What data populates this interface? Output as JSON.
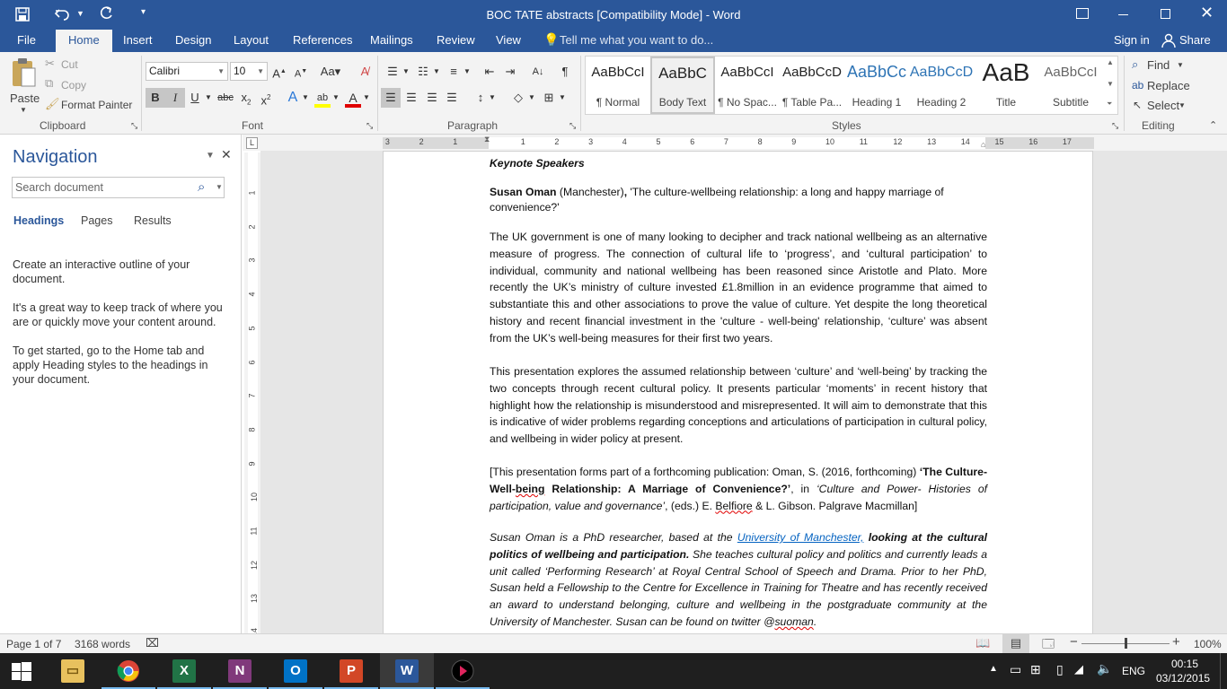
{
  "title_bar": {
    "title": "BOC TATE abstracts [Compatibility Mode] - Word"
  },
  "tabs": {
    "file": "File",
    "home": "Home",
    "insert": "Insert",
    "design": "Design",
    "layout": "Layout",
    "references": "References",
    "mailings": "Mailings",
    "review": "Review",
    "view": "View",
    "tell_me": "Tell me what you want to do...",
    "sign_in": "Sign in",
    "share": "Share"
  },
  "clipboard": {
    "paste": "Paste",
    "cut": "Cut",
    "copy": "Copy",
    "format_painter": "Format Painter",
    "label": "Clipboard"
  },
  "font": {
    "name": "Calibri",
    "size": "10",
    "label": "Font",
    "colors": {
      "highlight": "#ffff00",
      "font_color": "#e00000"
    }
  },
  "paragraph": {
    "label": "Paragraph"
  },
  "styles": {
    "label": "Styles",
    "items": [
      {
        "preview": "AaBbCcI",
        "name": "¶ Normal"
      },
      {
        "preview": "AaBbC",
        "name": "Body Text"
      },
      {
        "preview": "AaBbCcI",
        "name": "¶ No Spac..."
      },
      {
        "preview": "AaBbCcD",
        "name": "¶ Table Pa..."
      },
      {
        "preview": "AaBbCc",
        "name": "Heading 1"
      },
      {
        "preview": "AaBbCcD",
        "name": "Heading 2"
      },
      {
        "preview": "AaB",
        "name": "Title"
      },
      {
        "preview": "AaBbCcI",
        "name": "Subtitle"
      }
    ]
  },
  "editing": {
    "find": "Find",
    "replace": "Replace",
    "select": "Select",
    "label": "Editing"
  },
  "ruler": {
    "numbers": [
      "3",
      "2",
      "1",
      "1",
      "2",
      "3",
      "4",
      "5",
      "6",
      "7",
      "8",
      "9",
      "10",
      "11",
      "12",
      "13",
      "14",
      "15",
      "16",
      "17"
    ],
    "vnumbers": [
      "1",
      "2",
      "3",
      "4",
      "5",
      "6",
      "7",
      "8",
      "9",
      "10",
      "11",
      "12",
      "13",
      "14"
    ]
  },
  "navigation": {
    "title": "Navigation",
    "search_placeholder": "Search document",
    "tabs": [
      "Headings",
      "Pages",
      "Results"
    ],
    "para1": "Create an interactive outline of your document.",
    "para2": "It's a great way to keep track of where you are or quickly move your content around.",
    "para3": "To get started, go to the Home tab and apply Heading styles to the headings in your document."
  },
  "document": {
    "heading": "Keynote Speakers",
    "speaker_name": "Susan Oman",
    "speaker_place": " (Manchester)",
    "speaker_comma": ",",
    "talk_title": " 'The culture-wellbeing relationship: a long and happy marriage of convenience?'",
    "para1": "The UK government is one of many looking to decipher and track national wellbeing as an alternative measure of progress. The connection of cultural life to ‘progress’, and ‘cultural participation’ to individual, community and national wellbeing has been reasoned since Aristotle and Plato. More recently the UK’s ministry of culture invested £1.8million in an evidence programme that aimed to substantiate this and other associations to prove the value of culture. Yet despite the long theoretical history and recent financial investment in the 'culture - well-being' relationship, ‘culture’ was absent from the UK’s well-being measures for their first two years.",
    "para2": "This presentation explores the assumed relationship between ‘culture’ and ‘well-being’ by tracking the two concepts through recent cultural policy.  It presents particular ‘moments’ in recent history that highlight how the relationship is misunderstood and misrepresented. It will aim to demonstrate that this is indicative of wider problems regarding conceptions and articulations of participation in cultural policy, and wellbeing in wider policy at present.",
    "para3_a": "[This presentation forms part of a forthcoming publication: Oman, S. (2016, forthcoming) ",
    "para3_b1": "‘The Culture-Well-",
    "para3_b_squig": "being",
    "para3_b2": " Relationship: A Marriage of Convenience?’",
    "para3_c": ", in ",
    "para3_d": "‘Culture and Power- Histories of participation, value and governance’",
    "para3_e": ", (eds.) E. ",
    "para3_f": "Belfiore",
    "para3_g": " & L. Gibson. Palgrave Macmillan]",
    "bio_a": "Susan Oman is a PhD researcher, based at the ",
    "bio_link": "University of Manchester,",
    "bio_b": " looking at the cultural politics of wellbeing and participation.",
    "bio_c": " She teaches cultural policy and politics and currently leads a unit called ‘Performing Research’ at Royal Central School of Speech and Drama. Prior to her PhD, Susan held a Fellowship to the Centre for Excellence in Training for Theatre and has recently received an award to understand belonging, culture and wellbeing in the postgraduate community at the University of Manchester. Susan can be found on twitter @",
    "bio_handle": "suoman",
    "bio_end": "."
  },
  "status": {
    "page": "Page 1 of 7",
    "words": "3168 words",
    "zoom": "100%",
    "zoom_level": 100
  },
  "taskbar": {
    "lang": "ENG",
    "time": "00:15",
    "date": "03/12/2015",
    "apps": [
      "File Explorer",
      "Google Chrome",
      "Excel",
      "OneNote",
      "Outlook",
      "PowerPoint",
      "Word",
      "App"
    ]
  },
  "colors": {
    "word_blue": "#2b579a",
    "ribbon_bg": "#f3f3f3",
    "link": "#0563c1"
  }
}
